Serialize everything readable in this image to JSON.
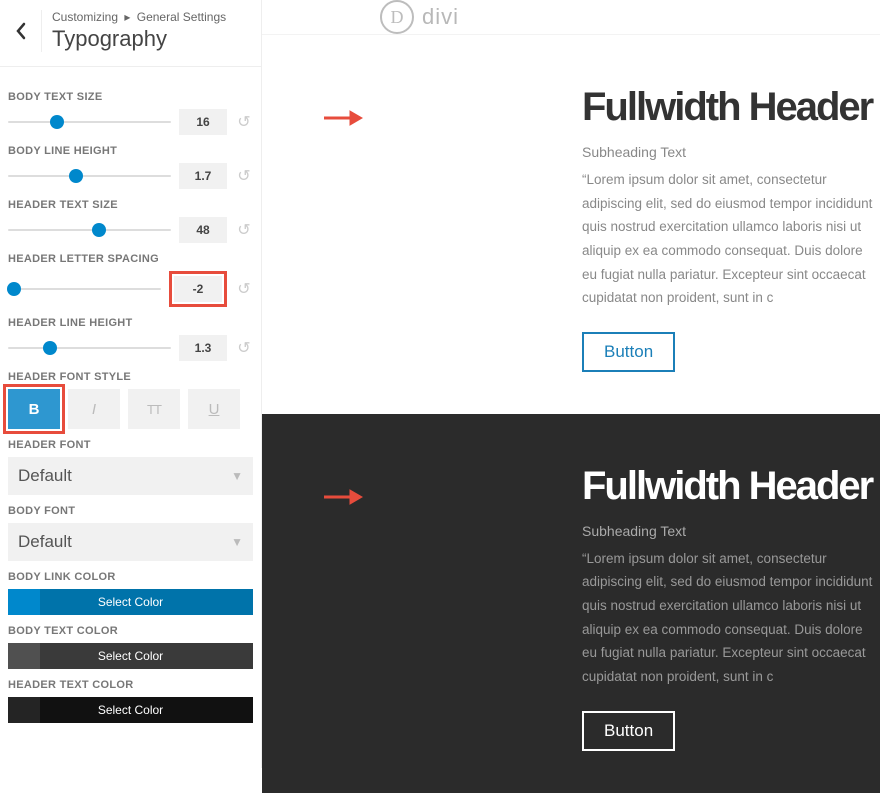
{
  "header": {
    "breadcrumb_parent": "Customizing",
    "breadcrumb_current": "General Settings",
    "title": "Typography"
  },
  "controls": {
    "body_text_size": {
      "label": "BODY TEXT SIZE",
      "value": "16",
      "thumb_pct": 30
    },
    "body_line_height": {
      "label": "BODY LINE HEIGHT",
      "value": "1.7",
      "thumb_pct": 42
    },
    "header_text_size": {
      "label": "HEADER TEXT SIZE",
      "value": "48",
      "thumb_pct": 56
    },
    "header_letter_spacing": {
      "label": "HEADER LETTER SPACING",
      "value": "-2",
      "thumb_pct": 4
    },
    "header_line_height": {
      "label": "HEADER LINE HEIGHT",
      "value": "1.3",
      "thumb_pct": 26
    },
    "header_font_style": {
      "label": "HEADER FONT STYLE",
      "bold": "B",
      "italic": "I",
      "uppercase": "TT",
      "underline": "U"
    },
    "header_font": {
      "label": "HEADER FONT",
      "value": "Default"
    },
    "body_font": {
      "label": "BODY FONT",
      "value": "Default"
    },
    "body_link_color": {
      "label": "BODY LINK COLOR",
      "button": "Select Color"
    },
    "body_text_color": {
      "label": "BODY TEXT COLOR",
      "button": "Select Color"
    },
    "header_text_color": {
      "label": "HEADER TEXT COLOR",
      "button": "Select Color"
    }
  },
  "preview": {
    "brand": "divi",
    "heading": "Fullwidth Header",
    "subheading": "Subheading Text",
    "paragraph": "“Lorem ipsum dolor sit amet, consectetur adipiscing elit, sed do eiusmod tempor incididunt quis nostrud exercitation ullamco laboris nisi ut aliquip ex ea commodo consequat. Duis dolore eu fugiat nulla pariatur. Excepteur sint occaecat cupidatat non proident, sunt in c",
    "button": "Button"
  }
}
